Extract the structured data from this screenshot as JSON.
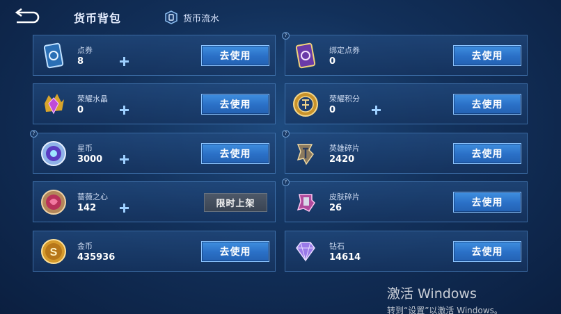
{
  "header": {
    "title": "货币背包",
    "flow_label": "货币流水"
  },
  "currencies": [
    {
      "name": "点券",
      "amount": "8",
      "action": "去使用",
      "has_plus": true,
      "icon": "ticket-card-icon"
    },
    {
      "name": "绑定点券",
      "amount": "0",
      "action": "去使用",
      "has_plus": false,
      "icon": "bound-ticket-card-icon"
    },
    {
      "name": "荣耀水晶",
      "amount": "0",
      "action": "去使用",
      "has_plus": true,
      "icon": "glory-crystal-icon"
    },
    {
      "name": "荣耀积分",
      "amount": "0",
      "action": "去使用",
      "has_plus": true,
      "icon": "glory-points-coin-icon"
    },
    {
      "name": "星币",
      "amount": "3000",
      "action": "去使用",
      "has_plus": true,
      "icon": "star-coin-icon"
    },
    {
      "name": "英雄碎片",
      "amount": "2420",
      "action": "去使用",
      "has_plus": false,
      "icon": "hero-shard-icon"
    },
    {
      "name": "蔷薇之心",
      "amount": "142",
      "action": "限时上架",
      "has_plus": true,
      "icon": "rose-heart-coin-icon"
    },
    {
      "name": "皮肤碎片",
      "amount": "26",
      "action": "去使用",
      "has_plus": false,
      "icon": "skin-shard-icon"
    },
    {
      "name": "金币",
      "amount": "435936",
      "action": "去使用",
      "has_plus": false,
      "icon": "gold-coin-icon"
    },
    {
      "name": "钻石",
      "amount": "14614",
      "action": "去使用",
      "has_plus": false,
      "icon": "diamond-icon"
    }
  ],
  "watermark": {
    "title": "激活 Windows",
    "subtitle": "转到“设置”以激活 Windows。"
  },
  "colors": {
    "background": "#12305a",
    "card": "#1f4a80",
    "button": "#2f7bd4",
    "disabled_tag": "#444e5c"
  }
}
